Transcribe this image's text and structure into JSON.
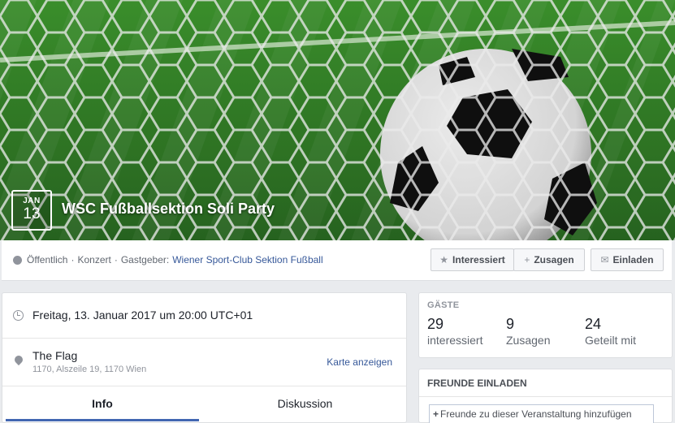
{
  "event": {
    "month": "JAN",
    "day": "13",
    "title": "WSC Fußballsektion Soli Party"
  },
  "meta": {
    "privacy": "Öffentlich",
    "sep": "·",
    "category": "Konzert",
    "host_label": "Gastgeber:",
    "host": "Wiener Sport-Club Sektion Fußball"
  },
  "actions": {
    "interested": "Interessiert",
    "going": "Zusagen",
    "invite": "Einladen"
  },
  "details": {
    "datetime": "Freitag, 13. Januar 2017 um 20:00 UTC+01",
    "location_name": "The Flag",
    "location_address": "1170, Alszeile 19, 1170 Wien",
    "map_link": "Karte anzeigen"
  },
  "tabs": [
    {
      "label": "Info"
    },
    {
      "label": "Diskussion"
    }
  ],
  "guests": {
    "heading": "GÄSTE",
    "stats": [
      {
        "num": "29",
        "label": "interessiert"
      },
      {
        "num": "9",
        "label": "Zusagen"
      },
      {
        "num": "24",
        "label": "Geteilt mit"
      }
    ]
  },
  "invite_friends": {
    "heading": "FREUNDE EINLADEN",
    "placeholder": "Freunde zu dieser Veranstaltung hinzufügen"
  },
  "colors": {
    "accent": "#4267b2",
    "link": "#365899",
    "grass": "#2f7a26"
  }
}
